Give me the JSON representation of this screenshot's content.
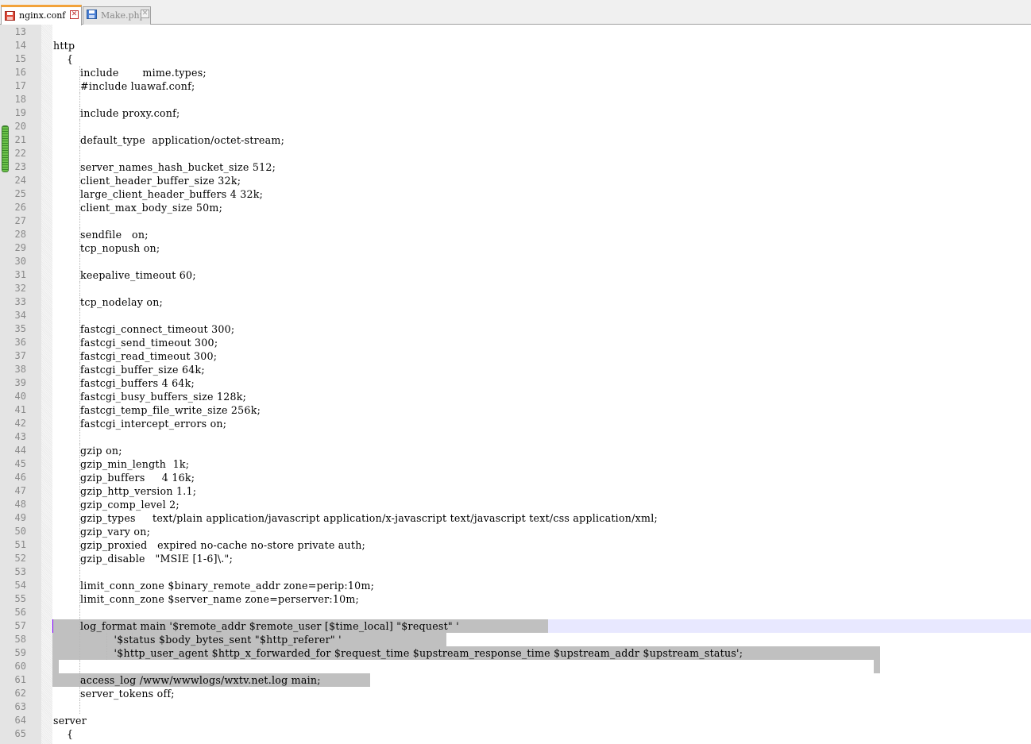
{
  "tabs": [
    {
      "label": "nginx.conf",
      "icon": "save-file-icon",
      "active": true
    },
    {
      "label": "Make.php",
      "icon": "file-icon",
      "active": false
    }
  ],
  "colors": {
    "active_tab_accent": "#f2a23a",
    "selection": "#c0c0c0",
    "current_line": "#e8e8ff",
    "change_bar": "#6cc24a",
    "caret": "#8000ff"
  },
  "editor": {
    "lines": [
      {
        "n": "13",
        "text": ""
      },
      {
        "n": "14",
        "text": "http"
      },
      {
        "n": "15",
        "text": "    {"
      },
      {
        "n": "16",
        "text": "        include       mime.types;"
      },
      {
        "n": "17",
        "text": "        #include luawaf.conf;"
      },
      {
        "n": "18",
        "text": ""
      },
      {
        "n": "19",
        "text": "        include proxy.conf;"
      },
      {
        "n": "20",
        "text": ""
      },
      {
        "n": "21",
        "text": "        default_type  application/octet-stream;"
      },
      {
        "n": "22",
        "text": ""
      },
      {
        "n": "23",
        "text": "        server_names_hash_bucket_size 512;"
      },
      {
        "n": "24",
        "text": "        client_header_buffer_size 32k;"
      },
      {
        "n": "25",
        "text": "        large_client_header_buffers 4 32k;"
      },
      {
        "n": "26",
        "text": "        client_max_body_size 50m;"
      },
      {
        "n": "27",
        "text": ""
      },
      {
        "n": "28",
        "text": "        sendfile   on;"
      },
      {
        "n": "29",
        "text": "        tcp_nopush on;"
      },
      {
        "n": "30",
        "text": ""
      },
      {
        "n": "31",
        "text": "        keepalive_timeout 60;"
      },
      {
        "n": "32",
        "text": ""
      },
      {
        "n": "33",
        "text": "        tcp_nodelay on;"
      },
      {
        "n": "34",
        "text": ""
      },
      {
        "n": "35",
        "text": "        fastcgi_connect_timeout 300;"
      },
      {
        "n": "36",
        "text": "        fastcgi_send_timeout 300;"
      },
      {
        "n": "37",
        "text": "        fastcgi_read_timeout 300;"
      },
      {
        "n": "38",
        "text": "        fastcgi_buffer_size 64k;"
      },
      {
        "n": "39",
        "text": "        fastcgi_buffers 4 64k;"
      },
      {
        "n": "40",
        "text": "        fastcgi_busy_buffers_size 128k;"
      },
      {
        "n": "41",
        "text": "        fastcgi_temp_file_write_size 256k;"
      },
      {
        "n": "42",
        "text": "        fastcgi_intercept_errors on;"
      },
      {
        "n": "43",
        "text": ""
      },
      {
        "n": "44",
        "text": "        gzip on;"
      },
      {
        "n": "45",
        "text": "        gzip_min_length  1k;"
      },
      {
        "n": "46",
        "text": "        gzip_buffers     4 16k;"
      },
      {
        "n": "47",
        "text": "        gzip_http_version 1.1;"
      },
      {
        "n": "48",
        "text": "        gzip_comp_level 2;"
      },
      {
        "n": "49",
        "text": "        gzip_types     text/plain application/javascript application/x-javascript text/javascript text/css application/xml;"
      },
      {
        "n": "50",
        "text": "        gzip_vary on;"
      },
      {
        "n": "51",
        "text": "        gzip_proxied   expired no-cache no-store private auth;"
      },
      {
        "n": "52",
        "text": "        gzip_disable   \"MSIE [1-6]\\.\";"
      },
      {
        "n": "53",
        "text": ""
      },
      {
        "n": "54",
        "text": "        limit_conn_zone $binary_remote_addr zone=perip:10m;"
      },
      {
        "n": "55",
        "text": "        limit_conn_zone $server_name zone=perserver:10m;"
      },
      {
        "n": "56",
        "text": ""
      },
      {
        "n": "57",
        "text": "        log_format main '$remote_addr $remote_user [$time_local] \"$request\" '"
      },
      {
        "n": "58",
        "text": "                  '$status $body_bytes_sent \"$http_referer\" '"
      },
      {
        "n": "59",
        "text": "                  '$http_user_agent $http_x_forwarded_for $request_time $upstream_response_time $upstream_addr $upstream_status';"
      },
      {
        "n": "60",
        "text": ""
      },
      {
        "n": "61",
        "text": "        access_log /www/wwwlogs/wxtv.net.log main;"
      },
      {
        "n": "62",
        "text": "        server_tokens off;"
      },
      {
        "n": "63",
        "text": ""
      },
      {
        "n": "64",
        "text": "server"
      },
      {
        "n": "65",
        "text": "    {"
      }
    ]
  }
}
